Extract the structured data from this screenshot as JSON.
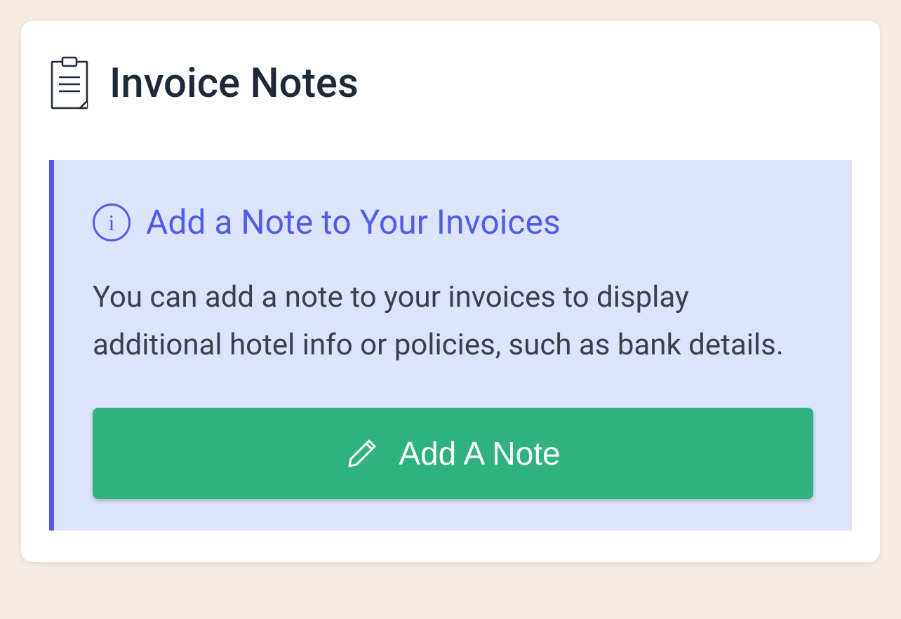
{
  "card": {
    "title": "Invoice Notes"
  },
  "info_panel": {
    "title": "Add a Note to Your Invoices",
    "description": "You can add a note to your invoices to display additional hotel info or policies, such as bank details."
  },
  "button": {
    "add_note_label": "Add A Note"
  }
}
